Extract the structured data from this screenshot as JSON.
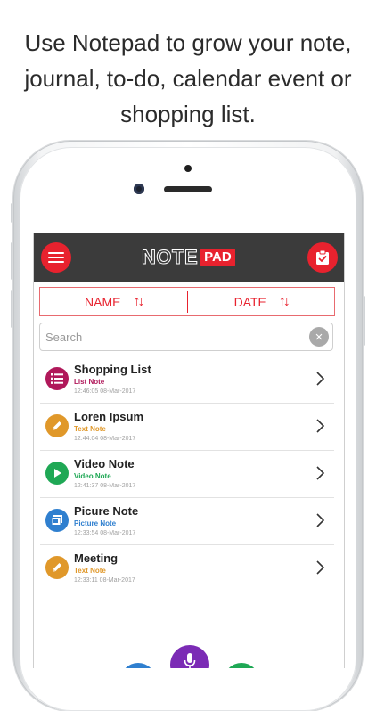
{
  "headline": {
    "line1": "Use Notepad to grow your note,",
    "line2": "journal, to-do, calendar event or",
    "line3": "shopping list."
  },
  "app": {
    "logo_note": "NOTE",
    "logo_pad": "PAD",
    "menu_icon": "hamburger-icon",
    "clipboard_icon": "clipboard-check-icon",
    "accent": "#e8222e",
    "topbar_color": "#3b3b3b"
  },
  "sort": {
    "name_label": "NAME",
    "date_label": "DATE",
    "arrows": "↑↓"
  },
  "search": {
    "placeholder": "Search",
    "clear_icon": "×"
  },
  "notes": [
    {
      "title": "Shopping List",
      "type": "List Note",
      "timestamp": "12:46:05 08-Mar-2017",
      "color": "#b0185a",
      "icon": "list-icon"
    },
    {
      "title": "Loren Ipsum",
      "type": "Text Note",
      "timestamp": "12:44:04 08-Mar-2017",
      "color": "#e0982a",
      "icon": "pencil-icon"
    },
    {
      "title": "Video Note",
      "type": "Video Note",
      "timestamp": "12:41:37 08-Mar-2017",
      "color": "#1fa855",
      "icon": "play-icon"
    },
    {
      "title": "Picure Note",
      "type": "Picture Note",
      "timestamp": "12:33:54 08-Mar-2017",
      "color": "#2f7fcf",
      "icon": "picture-icon"
    },
    {
      "title": "Meeting",
      "type": "Text Note",
      "timestamp": "12:33:11 08-Mar-2017",
      "color": "#e0982a",
      "icon": "pencil-icon"
    }
  ],
  "fabs": {
    "left_color": "#2f7fcf",
    "center_color": "#7b2bb5",
    "right_color": "#1fa855",
    "center_icon": "microphone-icon"
  }
}
